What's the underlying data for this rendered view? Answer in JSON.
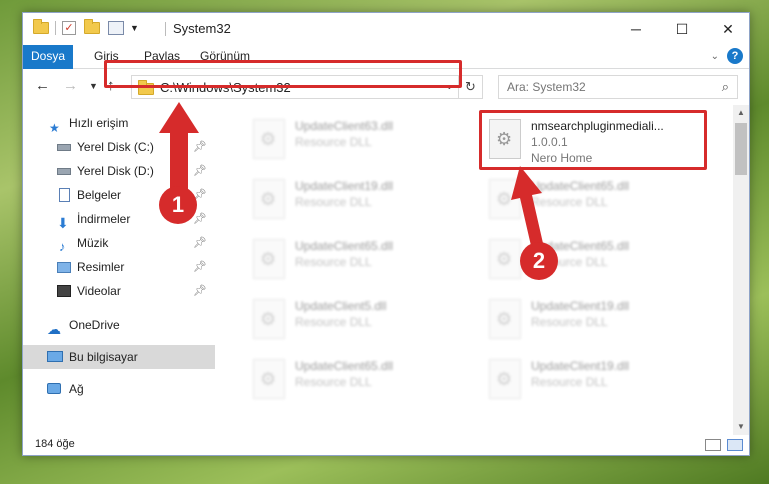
{
  "window": {
    "title": "System32",
    "controls": {
      "minimize": "─",
      "maximize": "☐",
      "close": "✕"
    }
  },
  "ribbon": {
    "tabs": [
      "Dosya",
      "Giriş",
      "Paylaş",
      "Görünüm"
    ]
  },
  "nav": {
    "address": "C:\\Windows\\System32",
    "search_placeholder": "Ara: System32"
  },
  "sidebar": {
    "items": [
      {
        "label": "Hızlı erişim",
        "icon": "star-icon"
      },
      {
        "label": "Yerel Disk (C:)",
        "icon": "drive-icon",
        "pinned": true
      },
      {
        "label": "Yerel Disk (D:)",
        "icon": "drive-icon",
        "pinned": true
      },
      {
        "label": "Belgeler",
        "icon": "documents-icon",
        "pinned": true
      },
      {
        "label": "İndirmeler",
        "icon": "download-icon",
        "pinned": true
      },
      {
        "label": "Müzik",
        "icon": "music-icon",
        "pinned": true
      },
      {
        "label": "Resimler",
        "icon": "pictures-icon",
        "pinned": true
      },
      {
        "label": "Videolar",
        "icon": "video-icon",
        "pinned": true
      },
      {
        "label": "OneDrive",
        "icon": "cloud-icon"
      },
      {
        "label": "Bu bilgisayar",
        "icon": "computer-icon",
        "selected": true
      },
      {
        "label": "Ağ",
        "icon": "network-icon"
      }
    ]
  },
  "files": [
    {
      "name": "UpdateClient63.dll",
      "desc": "Resource DLL",
      "highlighted": false
    },
    {
      "name": "nmsearchpluginmediali...",
      "desc": "1.0.0.1",
      "extra": "Nero Home",
      "highlighted": true
    },
    {
      "name": "UpdateClient19.dll",
      "desc": "Resource DLL",
      "highlighted": false
    },
    {
      "name": "UpdateClient65.dll",
      "desc": "Resource DLL",
      "highlighted": false
    },
    {
      "name": "UpdateClient65.dll",
      "desc": "Resource DLL",
      "highlighted": false
    },
    {
      "name": "UpdateClient65.dll",
      "desc": "Resource DLL",
      "highlighted": false
    },
    {
      "name": "UpdateClient5.dll",
      "desc": "Resource DLL",
      "highlighted": false
    },
    {
      "name": "UpdateClient19.dll",
      "desc": "Resource DLL",
      "highlighted": false
    },
    {
      "name": "UpdateClient65.dll",
      "desc": "Resource DLL",
      "highlighted": false
    },
    {
      "name": "UpdateClient19.dll",
      "desc": "Resource DLL",
      "highlighted": false
    }
  ],
  "status": {
    "item_count": "184 öğe"
  },
  "annotations": {
    "step1": "1",
    "step2": "2",
    "color": "#d62b2b"
  }
}
